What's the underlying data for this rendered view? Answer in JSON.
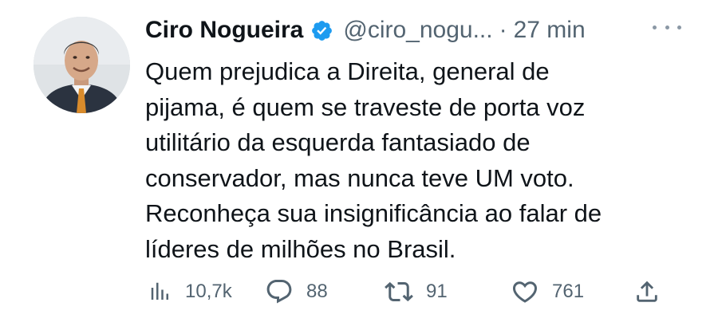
{
  "tweet": {
    "author_name": "Ciro Nogueira",
    "handle": "@ciro_nogu...",
    "separator": "·",
    "time": "27 min",
    "text_lines": [
      "Quem prejudica a Direita, general de",
      "pijama, é quem se traveste de porta voz",
      "utilitário da esquerda fantasiado de",
      "conservador, mas nunca teve UM voto.",
      "Reconheça sua insignificância ao falar de",
      "líderes de milhões no Brasil."
    ]
  },
  "actions": {
    "views": {
      "icon": "views-icon",
      "count": "10,7k"
    },
    "reply": {
      "icon": "reply-icon",
      "count": "88"
    },
    "retweet": {
      "icon": "retweet-icon",
      "count": "91"
    },
    "like": {
      "icon": "heart-icon",
      "count": "761"
    },
    "share": {
      "icon": "share-icon"
    }
  },
  "colors": {
    "text": "#0f1419",
    "secondary": "#536471",
    "verified": "#1d9bf0",
    "background": "#ffffff"
  }
}
